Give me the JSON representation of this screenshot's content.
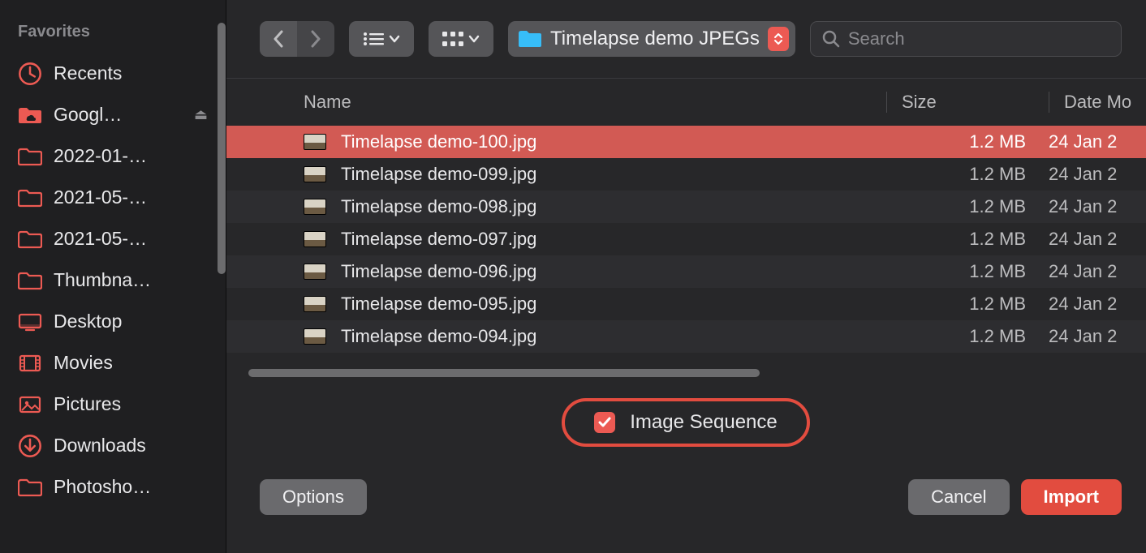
{
  "colors": {
    "accent": "#ec5a53"
  },
  "sidebar": {
    "heading": "Favorites",
    "items": [
      {
        "icon": "clock",
        "label": "Recents"
      },
      {
        "icon": "cloud-folder",
        "label": "Googl…",
        "ejectable": true
      },
      {
        "icon": "folder",
        "label": "2022-01-…"
      },
      {
        "icon": "folder",
        "label": "2021-05-…"
      },
      {
        "icon": "folder",
        "label": "2021-05-…"
      },
      {
        "icon": "folder",
        "label": "Thumbna…"
      },
      {
        "icon": "desktop",
        "label": "Desktop"
      },
      {
        "icon": "film",
        "label": "Movies"
      },
      {
        "icon": "picture",
        "label": "Pictures"
      },
      {
        "icon": "download",
        "label": "Downloads"
      },
      {
        "icon": "folder",
        "label": "Photosho…"
      }
    ]
  },
  "toolbar": {
    "path_label": "Timelapse demo JPEGs",
    "search_placeholder": "Search"
  },
  "columns": {
    "name": "Name",
    "size": "Size",
    "date": "Date Mo"
  },
  "files": [
    {
      "name": "Timelapse demo-100.jpg",
      "size": "1.2 MB",
      "date": "24 Jan 2",
      "selected": true
    },
    {
      "name": "Timelapse demo-099.jpg",
      "size": "1.2 MB",
      "date": "24 Jan 2"
    },
    {
      "name": "Timelapse demo-098.jpg",
      "size": "1.2 MB",
      "date": "24 Jan 2"
    },
    {
      "name": "Timelapse demo-097.jpg",
      "size": "1.2 MB",
      "date": "24 Jan 2"
    },
    {
      "name": "Timelapse demo-096.jpg",
      "size": "1.2 MB",
      "date": "24 Jan 2"
    },
    {
      "name": "Timelapse demo-095.jpg",
      "size": "1.2 MB",
      "date": "24 Jan 2"
    },
    {
      "name": "Timelapse demo-094.jpg",
      "size": "1.2 MB",
      "date": "24 Jan 2"
    }
  ],
  "sequence": {
    "label": "Image Sequence",
    "checked": true
  },
  "footer": {
    "options": "Options",
    "cancel": "Cancel",
    "import": "Import"
  }
}
